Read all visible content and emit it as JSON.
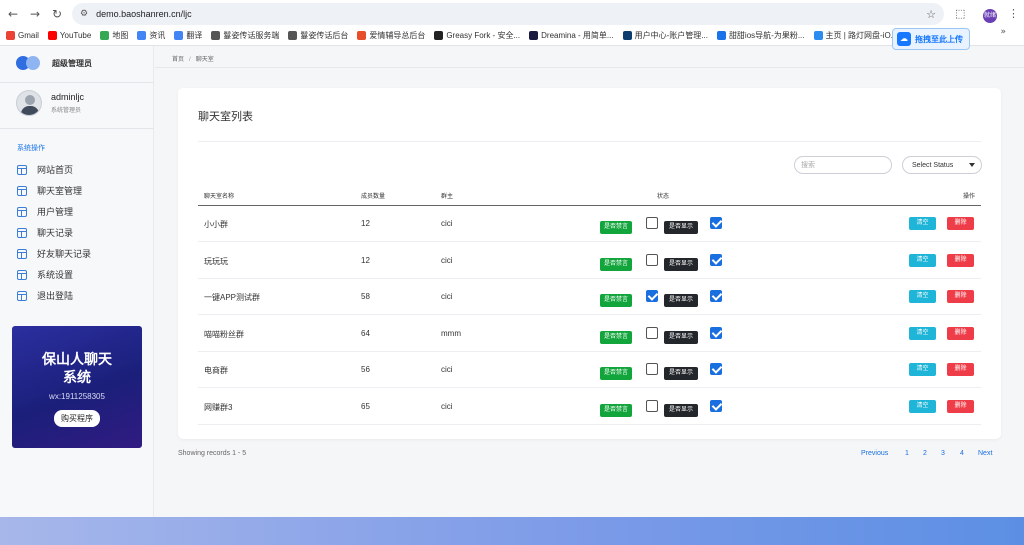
{
  "browser": {
    "url": "demo.baoshanren.cn/ljc",
    "profile_label": "就绪",
    "bookmarks": [
      {
        "label": "Gmail",
        "color": "#ea4335"
      },
      {
        "label": "YouTube",
        "color": "#ff0000"
      },
      {
        "label": "地图",
        "color": "#34a853"
      },
      {
        "label": "资讯",
        "color": "#4285f4"
      },
      {
        "label": "翻译",
        "color": "#4285f4"
      },
      {
        "label": "鬘姿传话服务端",
        "color": "#555555"
      },
      {
        "label": "鬘姿传话后台",
        "color": "#555555"
      },
      {
        "label": "爱情辅导总后台",
        "color": "#e94e2b"
      },
      {
        "label": "Greasy Fork - 安全...",
        "color": "#222222"
      },
      {
        "label": "Dreamina - 用简单...",
        "color": "#1a1a40"
      },
      {
        "label": "用户中心-账户管理...",
        "color": "#0b3d6e"
      },
      {
        "label": "甜甜ios导航-为果粉...",
        "color": "#1a73e8"
      },
      {
        "label": "主页 | 路灯网盘-iO...",
        "color": "#2d8cf0"
      }
    ],
    "upload_chip": "拖拽至此上传"
  },
  "sidebar": {
    "brand": "超级管理员",
    "user_name": "adminljc",
    "user_role": "系统管理员",
    "section_title": "系统操作",
    "items": [
      {
        "label": "网站首页"
      },
      {
        "label": "聊天室管理"
      },
      {
        "label": "用户管理"
      },
      {
        "label": "聊天记录"
      },
      {
        "label": "好友聊天记录"
      },
      {
        "label": "系统设置"
      },
      {
        "label": "退出登陆"
      }
    ],
    "promo": {
      "title_line1": "保山人聊天",
      "title_line2": "系统",
      "wx": "wx:1911258305",
      "button": "购买程序"
    }
  },
  "breadcrumb": {
    "home": "首页",
    "sep": "/",
    "current": "聊天室"
  },
  "page": {
    "title": "聊天室列表",
    "search_placeholder": "搜索",
    "status_select": "Select Status"
  },
  "table": {
    "headers": [
      "聊天室名称",
      "成员数量",
      "群主",
      "状态",
      "操作"
    ],
    "mute_label": "是否禁言",
    "show_label": "是否显示",
    "clear_label": "清空",
    "delete_label": "删除",
    "rows": [
      {
        "name": "小小群",
        "members": "12",
        "owner": "cici",
        "muted": false,
        "shown": true
      },
      {
        "name": "玩玩玩",
        "members": "12",
        "owner": "cici",
        "muted": false,
        "shown": true
      },
      {
        "name": "一键APP测试群",
        "members": "58",
        "owner": "cici",
        "muted": true,
        "shown": true
      },
      {
        "name": "喵喵粉丝群",
        "members": "64",
        "owner": "mmm",
        "muted": false,
        "shown": true
      },
      {
        "name": "电商群",
        "members": "56",
        "owner": "cici",
        "muted": false,
        "shown": true
      },
      {
        "name": "网赚群3",
        "members": "65",
        "owner": "cici",
        "muted": false,
        "shown": true
      }
    ]
  },
  "footer": {
    "records": "Showing records 1 - 5",
    "previous": "Previous",
    "pages": [
      "1",
      "2",
      "3",
      "4"
    ],
    "next": "Next"
  },
  "colors": {
    "accent": "#1a6fe0",
    "mute_badge": "#12a53b",
    "show_badge": "#23262b",
    "clear_button": "#1eb5d8",
    "delete_button": "#ee3d48"
  }
}
